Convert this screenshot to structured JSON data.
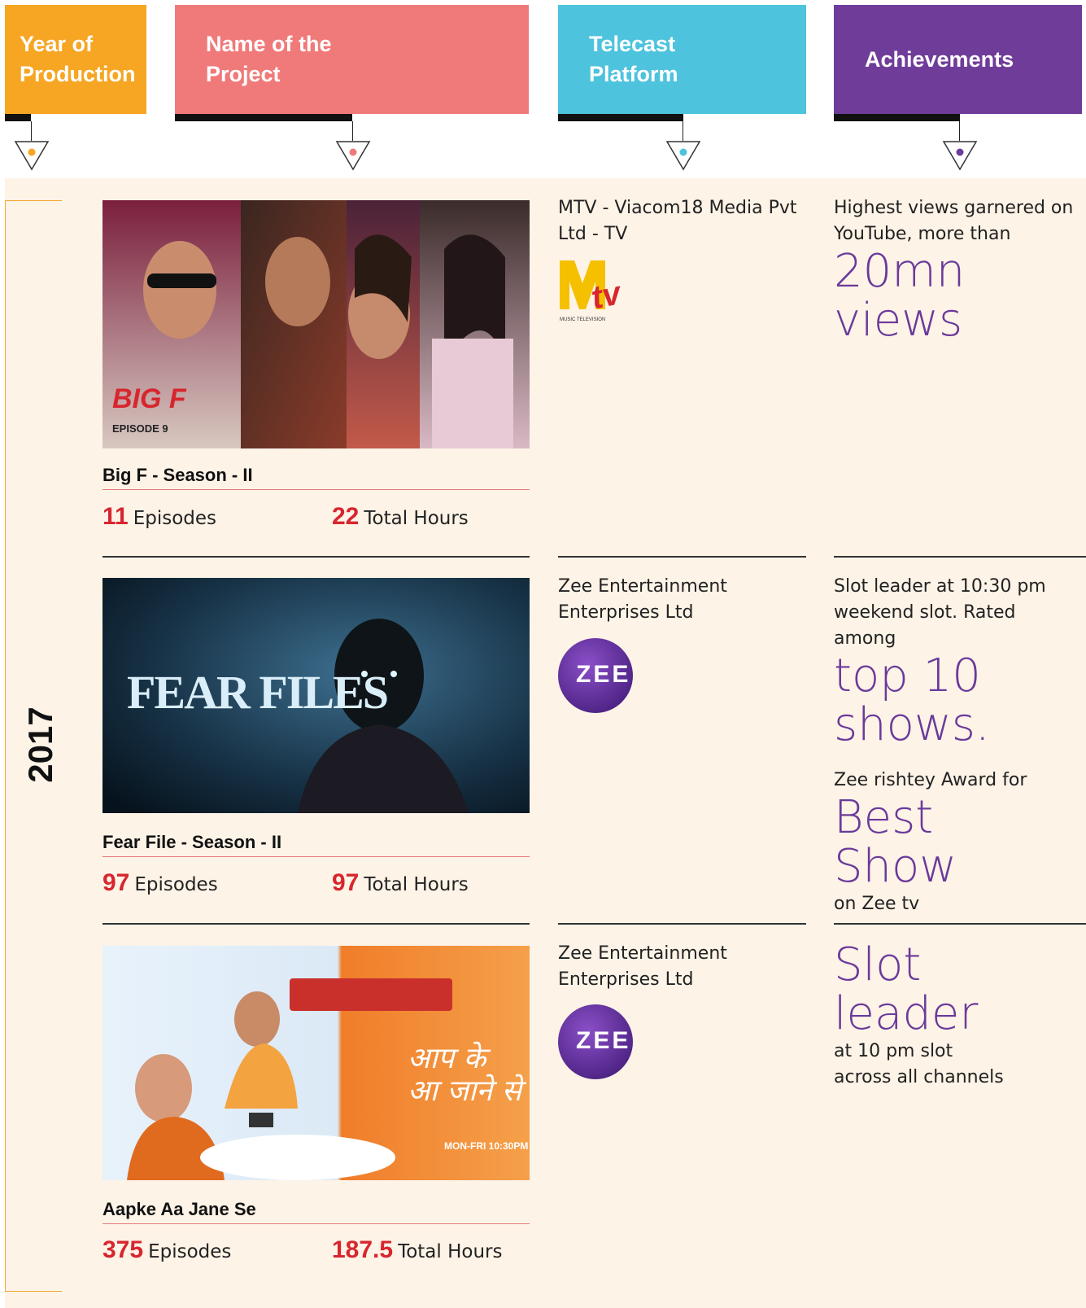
{
  "headers": {
    "year": "Year of\nProduction",
    "project": "Name of the\nProject",
    "platform": "Telecast\nPlatform",
    "achievements": "Achievements"
  },
  "colors": {
    "year": "#f6a623",
    "project": "#f07a7a",
    "platform": "#4ec3dd",
    "achievements": "#6f3c9a",
    "stat_number": "#d7262e",
    "achievement_big": "#6a3a9a",
    "panel_bg": "#fdf3e7"
  },
  "year": "2017",
  "projects": [
    {
      "title": "Big F - Season - II",
      "episodes_value": "11",
      "episodes_label": "Episodes",
      "hours_value": "22",
      "hours_label": "Total Hours",
      "thumb_text_1": "BIG F",
      "thumb_text_2": "EPISODE 9",
      "platform": "MTV - Viacom18 Media Pvt Ltd - TV",
      "logo": "MTV",
      "logo_sub": "MUSIC TELEVISION",
      "achievement": {
        "intro": "Highest views garnered on YouTube, more than",
        "big": "20mn views"
      }
    },
    {
      "title": "Fear File - Season - II",
      "episodes_value": "97",
      "episodes_label": "Episodes",
      "hours_value": "97",
      "hours_label": "Total Hours",
      "thumb_text_1": "FEAR FILES",
      "platform": "Zee Entertainment Enterprises Ltd",
      "logo": "ZEE",
      "achievement": {
        "intro": "Slot leader at 10:30 pm weekend slot. Rated among",
        "big": "top 10 shows.",
        "intro2": "Zee rishtey Award for",
        "big2": "Best Show",
        "outro": "on Zee tv"
      }
    },
    {
      "title": "Aapke Aa Jane Se",
      "episodes_value": "375",
      "episodes_label": "Episodes",
      "hours_value": "187.5",
      "hours_label": "Total Hours",
      "thumb_text_2": "MON-FRI 10:30PM",
      "platform": "Zee Entertainment Enterprises Ltd",
      "logo": "ZEE",
      "achievement": {
        "big": "Slot leader",
        "outro": "at 10 pm slot across all channels"
      }
    }
  ]
}
